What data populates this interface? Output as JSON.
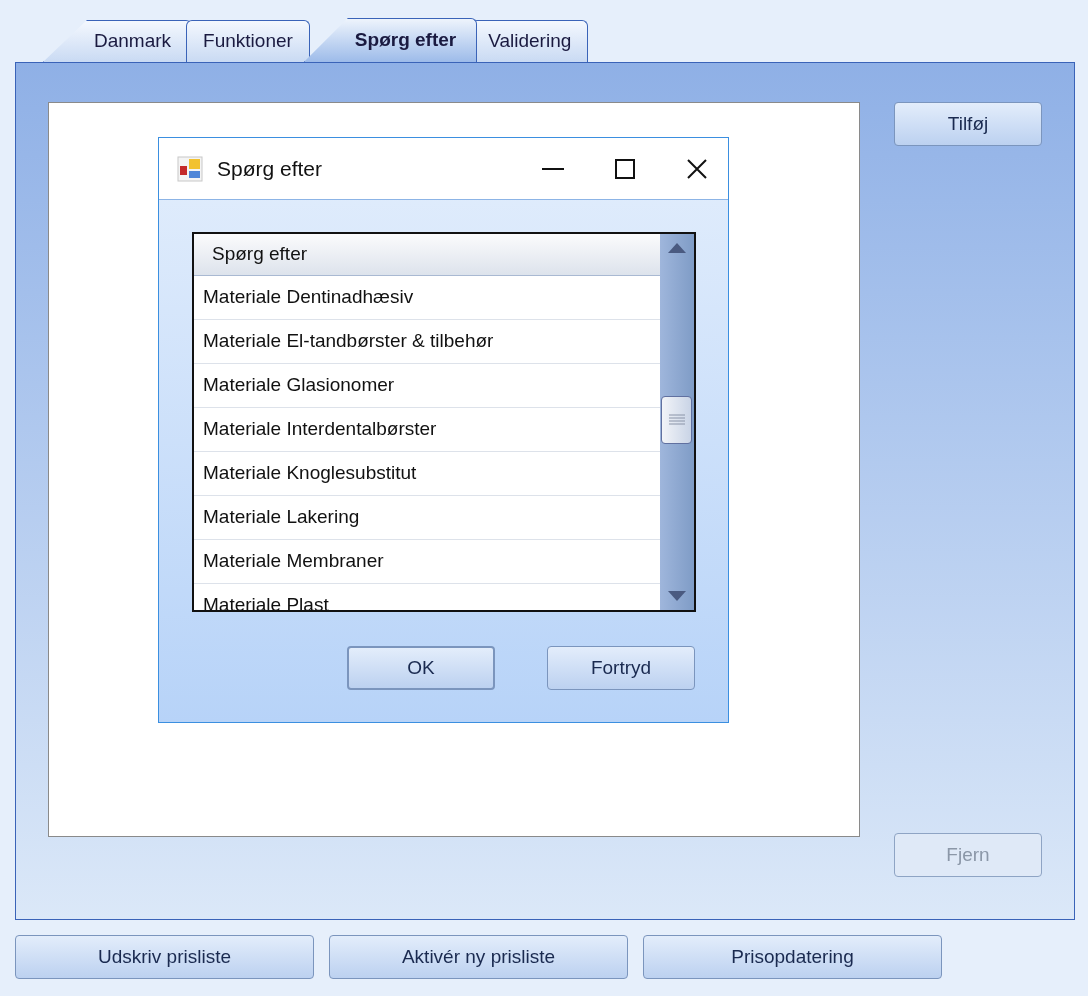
{
  "tabs": [
    {
      "label": "Danmark",
      "selected": false
    },
    {
      "label": "Funktioner",
      "selected": false
    },
    {
      "label": "Spørg efter",
      "selected": true
    },
    {
      "label": "Validering",
      "selected": false
    }
  ],
  "side_buttons": [
    {
      "label": "Tilføj",
      "disabled": false
    },
    {
      "label": "Fjern",
      "disabled": true
    }
  ],
  "bottom_buttons": [
    "Udskriv prisliste",
    "Aktivér ny prisliste",
    "Prisopdatering"
  ],
  "dialog": {
    "title": "Spørg efter",
    "list": {
      "column": "Spørg efter",
      "rows": [
        "Materiale Dentinadhæsiv",
        "Materiale El-tandbørster & tilbehør",
        "Materiale Glasionomer",
        "Materiale Interdentalbørster",
        "Materiale Knoglesubstitut",
        "Materiale Lakering",
        "Materiale Membraner",
        "Materiale Plast"
      ]
    },
    "buttons": [
      "OK",
      "Fortryd"
    ]
  }
}
